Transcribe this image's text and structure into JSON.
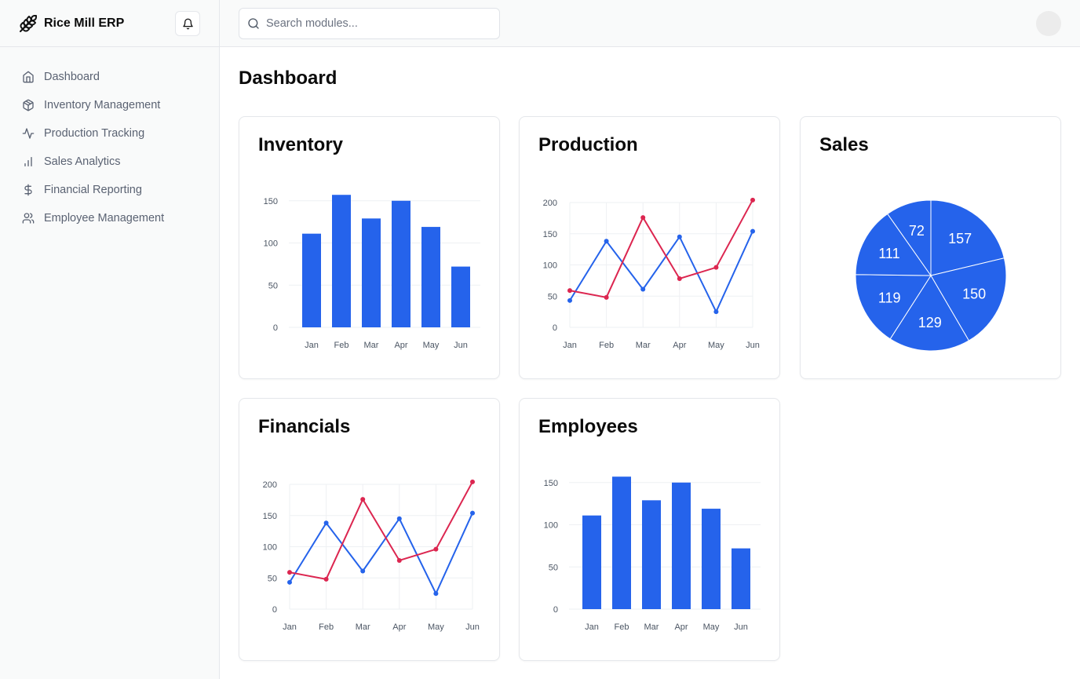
{
  "app": {
    "title": "Rice Mill ERP"
  },
  "sidebar": {
    "items": [
      {
        "label": "Dashboard",
        "icon": "home-icon"
      },
      {
        "label": "Inventory Management",
        "icon": "package-icon"
      },
      {
        "label": "Production Tracking",
        "icon": "activity-icon"
      },
      {
        "label": "Sales Analytics",
        "icon": "bar-chart-icon"
      },
      {
        "label": "Financial Reporting",
        "icon": "dollar-icon"
      },
      {
        "label": "Employee Management",
        "icon": "users-icon"
      }
    ]
  },
  "search": {
    "placeholder": "Search modules..."
  },
  "page": {
    "title": "Dashboard"
  },
  "colors": {
    "primary": "#2563eb",
    "secondary": "#dc2650"
  },
  "cards": {
    "inventory": {
      "title": "Inventory"
    },
    "production": {
      "title": "Production"
    },
    "sales": {
      "title": "Sales"
    },
    "financials": {
      "title": "Financials"
    },
    "employees": {
      "title": "Employees"
    }
  },
  "chart_data": [
    {
      "id": "inventory",
      "type": "bar",
      "categories": [
        "Jan",
        "Feb",
        "Mar",
        "Apr",
        "May",
        "Jun"
      ],
      "values": [
        111,
        157,
        129,
        150,
        119,
        72
      ],
      "yticks": [
        0,
        50,
        100,
        150
      ],
      "ylim": [
        0,
        160
      ],
      "title": "Inventory",
      "grid": true
    },
    {
      "id": "production",
      "type": "line",
      "categories": [
        "Jan",
        "Feb",
        "Mar",
        "Apr",
        "May",
        "Jun"
      ],
      "series": [
        {
          "values": [
            43,
            138,
            61,
            145,
            25,
            154
          ],
          "color": "#2563eb"
        },
        {
          "values": [
            59,
            48,
            176,
            78,
            96,
            204
          ],
          "color": "#dc2650"
        }
      ],
      "yticks": [
        0,
        50,
        100,
        150,
        200
      ],
      "ylim": [
        0,
        200
      ],
      "title": "Production",
      "grid": true
    },
    {
      "id": "sales",
      "type": "pie",
      "values": [
        157,
        150,
        129,
        119,
        111,
        72
      ],
      "title": "Sales"
    },
    {
      "id": "financials",
      "type": "line",
      "categories": [
        "Jan",
        "Feb",
        "Mar",
        "Apr",
        "May",
        "Jun"
      ],
      "series": [
        {
          "values": [
            43,
            138,
            61,
            145,
            25,
            154
          ],
          "color": "#2563eb"
        },
        {
          "values": [
            59,
            48,
            176,
            78,
            96,
            204
          ],
          "color": "#dc2650"
        }
      ],
      "yticks": [
        0,
        50,
        100,
        150,
        200
      ],
      "ylim": [
        0,
        200
      ],
      "title": "Financials",
      "grid": true
    },
    {
      "id": "employees",
      "type": "bar",
      "categories": [
        "Jan",
        "Feb",
        "Mar",
        "Apr",
        "May",
        "Jun"
      ],
      "values": [
        111,
        157,
        129,
        150,
        119,
        72
      ],
      "yticks": [
        0,
        50,
        100,
        150
      ],
      "ylim": [
        0,
        160
      ],
      "title": "Employees",
      "grid": true
    }
  ]
}
